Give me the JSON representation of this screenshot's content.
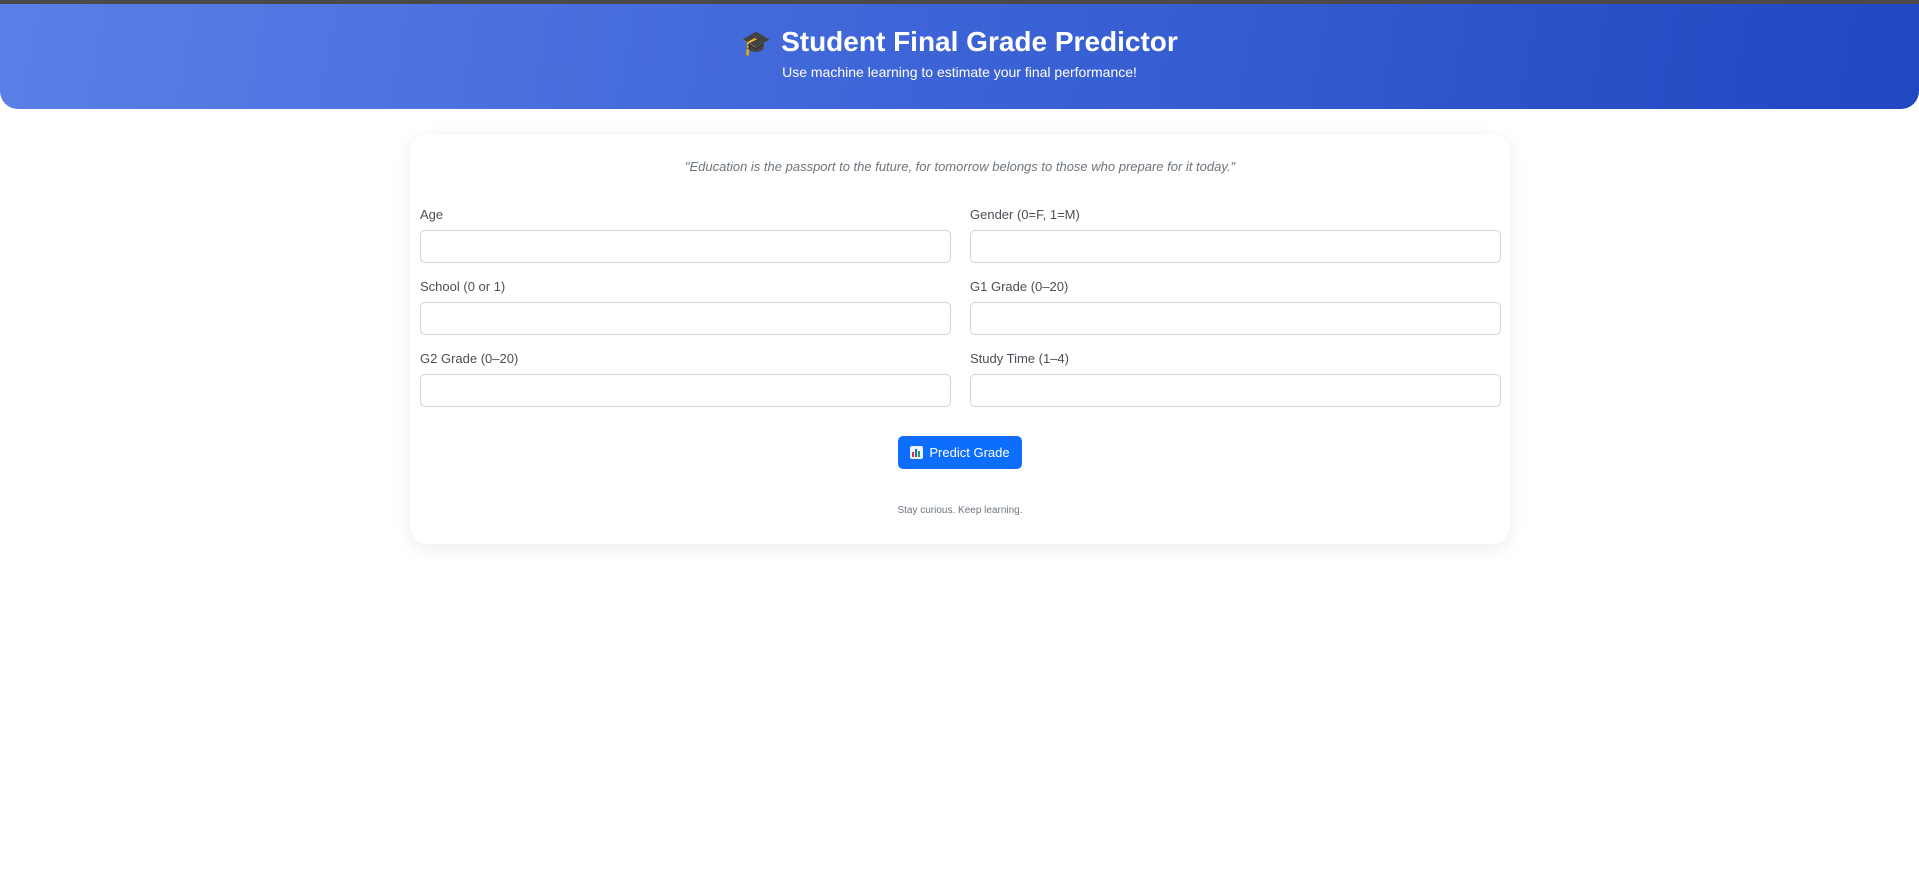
{
  "header": {
    "icon": "graduation-cap-icon",
    "title": "Student Final Grade Predictor",
    "subtitle": "Use machine learning to estimate your final performance!"
  },
  "card": {
    "quote": "\"Education is the passport to the future, for tomorrow belongs to those who prepare for it today.\"",
    "fields": [
      {
        "label": "Age",
        "value": ""
      },
      {
        "label": "Gender (0=F, 1=M)",
        "value": ""
      },
      {
        "label": "School (0 or 1)",
        "value": ""
      },
      {
        "label": "G1 Grade (0–20)",
        "value": ""
      },
      {
        "label": "G2 Grade (0–20)",
        "value": ""
      },
      {
        "label": "Study Time (1–4)",
        "value": ""
      }
    ],
    "button": {
      "icon": "bar-chart-icon",
      "label": "Predict Grade"
    },
    "footer": "Stay curious. Keep learning."
  },
  "colors": {
    "header_gradient_start": "#5a7fe6",
    "header_gradient_end": "#2147c1",
    "button": "#0d6efd",
    "quote_text": "#6c757d"
  }
}
